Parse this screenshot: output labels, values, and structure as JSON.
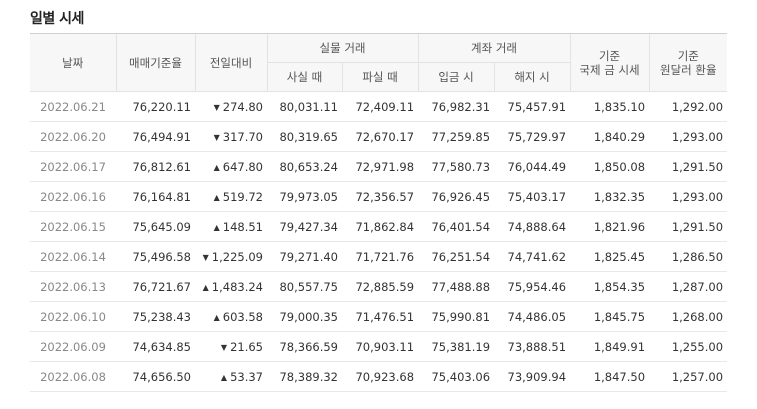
{
  "title": "일별 시세",
  "headers": {
    "date": "날짜",
    "base_rate": "매매기준율",
    "change": "전일대비",
    "cash_group": "실물 거래",
    "cash_buy": "사실 때",
    "cash_sell": "파실 때",
    "transfer_group": "계좌 거래",
    "deposit": "입금 시",
    "withdraw": "해지 시",
    "intl_line1": "기준",
    "intl_line2": "국제 금 시세",
    "fx_line1": "기준",
    "fx_line2": "원달러 환율"
  },
  "rows": [
    {
      "date": "2022.06.21",
      "base_rate": "76,220.11",
      "direction": "down",
      "change": "274.80",
      "cash_buy": "80,031.11",
      "cash_sell": "72,409.11",
      "deposit": "76,982.31",
      "withdraw": "75,457.91",
      "intl": "1,835.10",
      "fx": "1,292.00"
    },
    {
      "date": "2022.06.20",
      "base_rate": "76,494.91",
      "direction": "down",
      "change": "317.70",
      "cash_buy": "80,319.65",
      "cash_sell": "72,670.17",
      "deposit": "77,259.85",
      "withdraw": "75,729.97",
      "intl": "1,840.29",
      "fx": "1,293.00"
    },
    {
      "date": "2022.06.17",
      "base_rate": "76,812.61",
      "direction": "up",
      "change": "647.80",
      "cash_buy": "80,653.24",
      "cash_sell": "72,971.98",
      "deposit": "77,580.73",
      "withdraw": "76,044.49",
      "intl": "1,850.08",
      "fx": "1,291.50"
    },
    {
      "date": "2022.06.16",
      "base_rate": "76,164.81",
      "direction": "up",
      "change": "519.72",
      "cash_buy": "79,973.05",
      "cash_sell": "72,356.57",
      "deposit": "76,926.45",
      "withdraw": "75,403.17",
      "intl": "1,832.35",
      "fx": "1,293.00"
    },
    {
      "date": "2022.06.15",
      "base_rate": "75,645.09",
      "direction": "up",
      "change": "148.51",
      "cash_buy": "79,427.34",
      "cash_sell": "71,862.84",
      "deposit": "76,401.54",
      "withdraw": "74,888.64",
      "intl": "1,821.96",
      "fx": "1,291.50"
    },
    {
      "date": "2022.06.14",
      "base_rate": "75,496.58",
      "direction": "down",
      "change": "1,225.09",
      "cash_buy": "79,271.40",
      "cash_sell": "71,721.76",
      "deposit": "76,251.54",
      "withdraw": "74,741.62",
      "intl": "1,825.45",
      "fx": "1,286.50"
    },
    {
      "date": "2022.06.13",
      "base_rate": "76,721.67",
      "direction": "up",
      "change": "1,483.24",
      "cash_buy": "80,557.75",
      "cash_sell": "72,885.59",
      "deposit": "77,488.88",
      "withdraw": "75,954.46",
      "intl": "1,854.35",
      "fx": "1,287.00"
    },
    {
      "date": "2022.06.10",
      "base_rate": "75,238.43",
      "direction": "up",
      "change": "603.58",
      "cash_buy": "79,000.35",
      "cash_sell": "71,476.51",
      "deposit": "75,990.81",
      "withdraw": "74,486.05",
      "intl": "1,845.75",
      "fx": "1,268.00"
    },
    {
      "date": "2022.06.09",
      "base_rate": "74,634.85",
      "direction": "down",
      "change": "21.65",
      "cash_buy": "78,366.59",
      "cash_sell": "70,903.11",
      "deposit": "75,381.19",
      "withdraw": "73,888.51",
      "intl": "1,849.91",
      "fx": "1,255.00"
    },
    {
      "date": "2022.06.08",
      "base_rate": "74,656.50",
      "direction": "up",
      "change": "53.37",
      "cash_buy": "78,389.32",
      "cash_sell": "70,923.68",
      "deposit": "75,403.06",
      "withdraw": "73,909.94",
      "intl": "1,847.50",
      "fx": "1,257.00"
    }
  ],
  "colors": {
    "up": "#d12b2b",
    "down": "#1a4f9c"
  }
}
